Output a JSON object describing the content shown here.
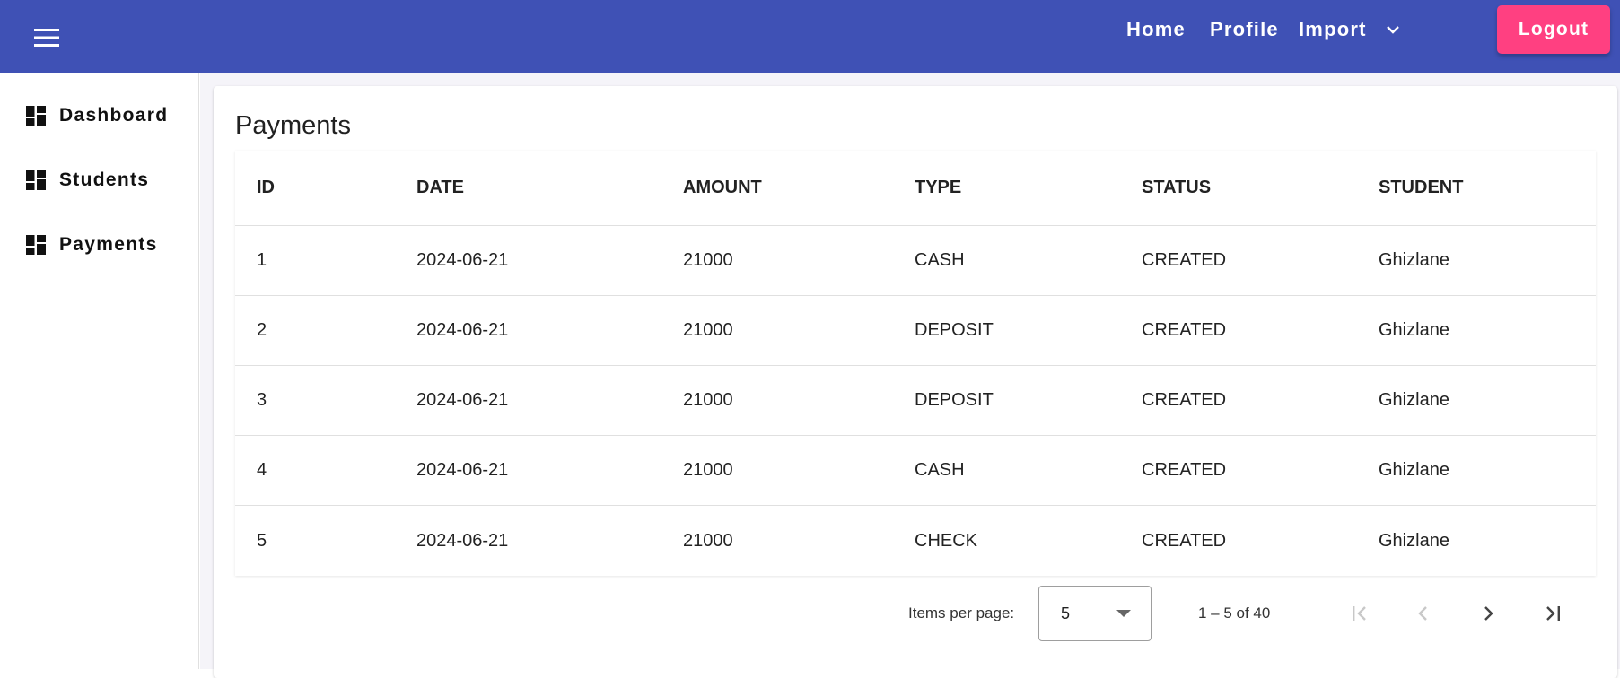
{
  "header": {
    "menu_icon": "menu-icon",
    "nav": {
      "home": "Home",
      "profile": "Profile",
      "import": "Import"
    },
    "logout": "Logout",
    "colors": {
      "primary": "#3f51b5",
      "accent": "#ff4081"
    }
  },
  "sidebar": {
    "items": [
      {
        "label": "Dashboard",
        "icon": "dashboard-icon"
      },
      {
        "label": "Students",
        "icon": "dashboard-icon"
      },
      {
        "label": "Payments",
        "icon": "dashboard-icon"
      }
    ]
  },
  "main": {
    "title": "Payments",
    "table": {
      "columns": [
        "ID",
        "DATE",
        "AMOUNT",
        "TYPE",
        "STATUS",
        "STUDENT"
      ],
      "rows": [
        [
          "1",
          "2024-06-21",
          "21000",
          "CASH",
          "CREATED",
          "Ghizlane"
        ],
        [
          "2",
          "2024-06-21",
          "21000",
          "DEPOSIT",
          "CREATED",
          "Ghizlane"
        ],
        [
          "3",
          "2024-06-21",
          "21000",
          "DEPOSIT",
          "CREATED",
          "Ghizlane"
        ],
        [
          "4",
          "2024-06-21",
          "21000",
          "CASH",
          "CREATED",
          "Ghizlane"
        ],
        [
          "5",
          "2024-06-21",
          "21000",
          "CHECK",
          "CREATED",
          "Ghizlane"
        ]
      ]
    },
    "paginator": {
      "items_per_page_label": "Items per page:",
      "page_size": "5",
      "range_label": "1 – 5 of 40"
    }
  }
}
